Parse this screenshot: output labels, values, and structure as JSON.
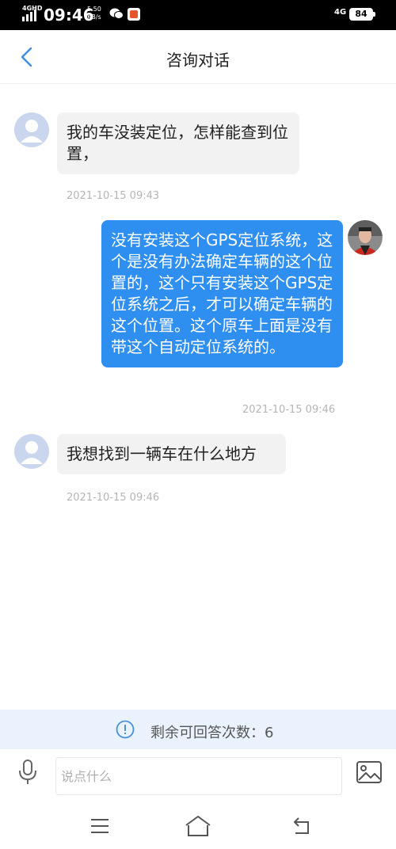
{
  "status_bar": {
    "network_type": "4GHD",
    "time": "09:46",
    "speed_value": "5.50",
    "speed_unit": "KB/s",
    "network_right": "4G",
    "battery": "84"
  },
  "header": {
    "title": "咨询对话",
    "back_icon": "chevron-left-icon"
  },
  "messages": [
    {
      "side": "left",
      "text": "我的车没装定位，怎样能查到位置，",
      "time": "2021-10-15 09:43"
    },
    {
      "side": "right",
      "text": "没有安装这个GPS定位系统，这个是没有办法确定车辆的这个位置的，这个只有安装这个GPS定位系统之后，才可以确定车辆的这个位置。这个原车上面是没有带这个自动定位系统的。",
      "time": "2021-10-15 09:46"
    },
    {
      "side": "left",
      "text": "我想找到一辆车在什么地方",
      "time": "2021-10-15 09:46"
    }
  ],
  "notice": {
    "icon": "info-icon",
    "text": "剩余可回答次数：6"
  },
  "input": {
    "placeholder": "说点什么",
    "value": ""
  },
  "colors": {
    "accent_blue": "#2f8ff0",
    "notice_bg": "#eaf3fd",
    "icon_blue": "#4a90d9"
  }
}
